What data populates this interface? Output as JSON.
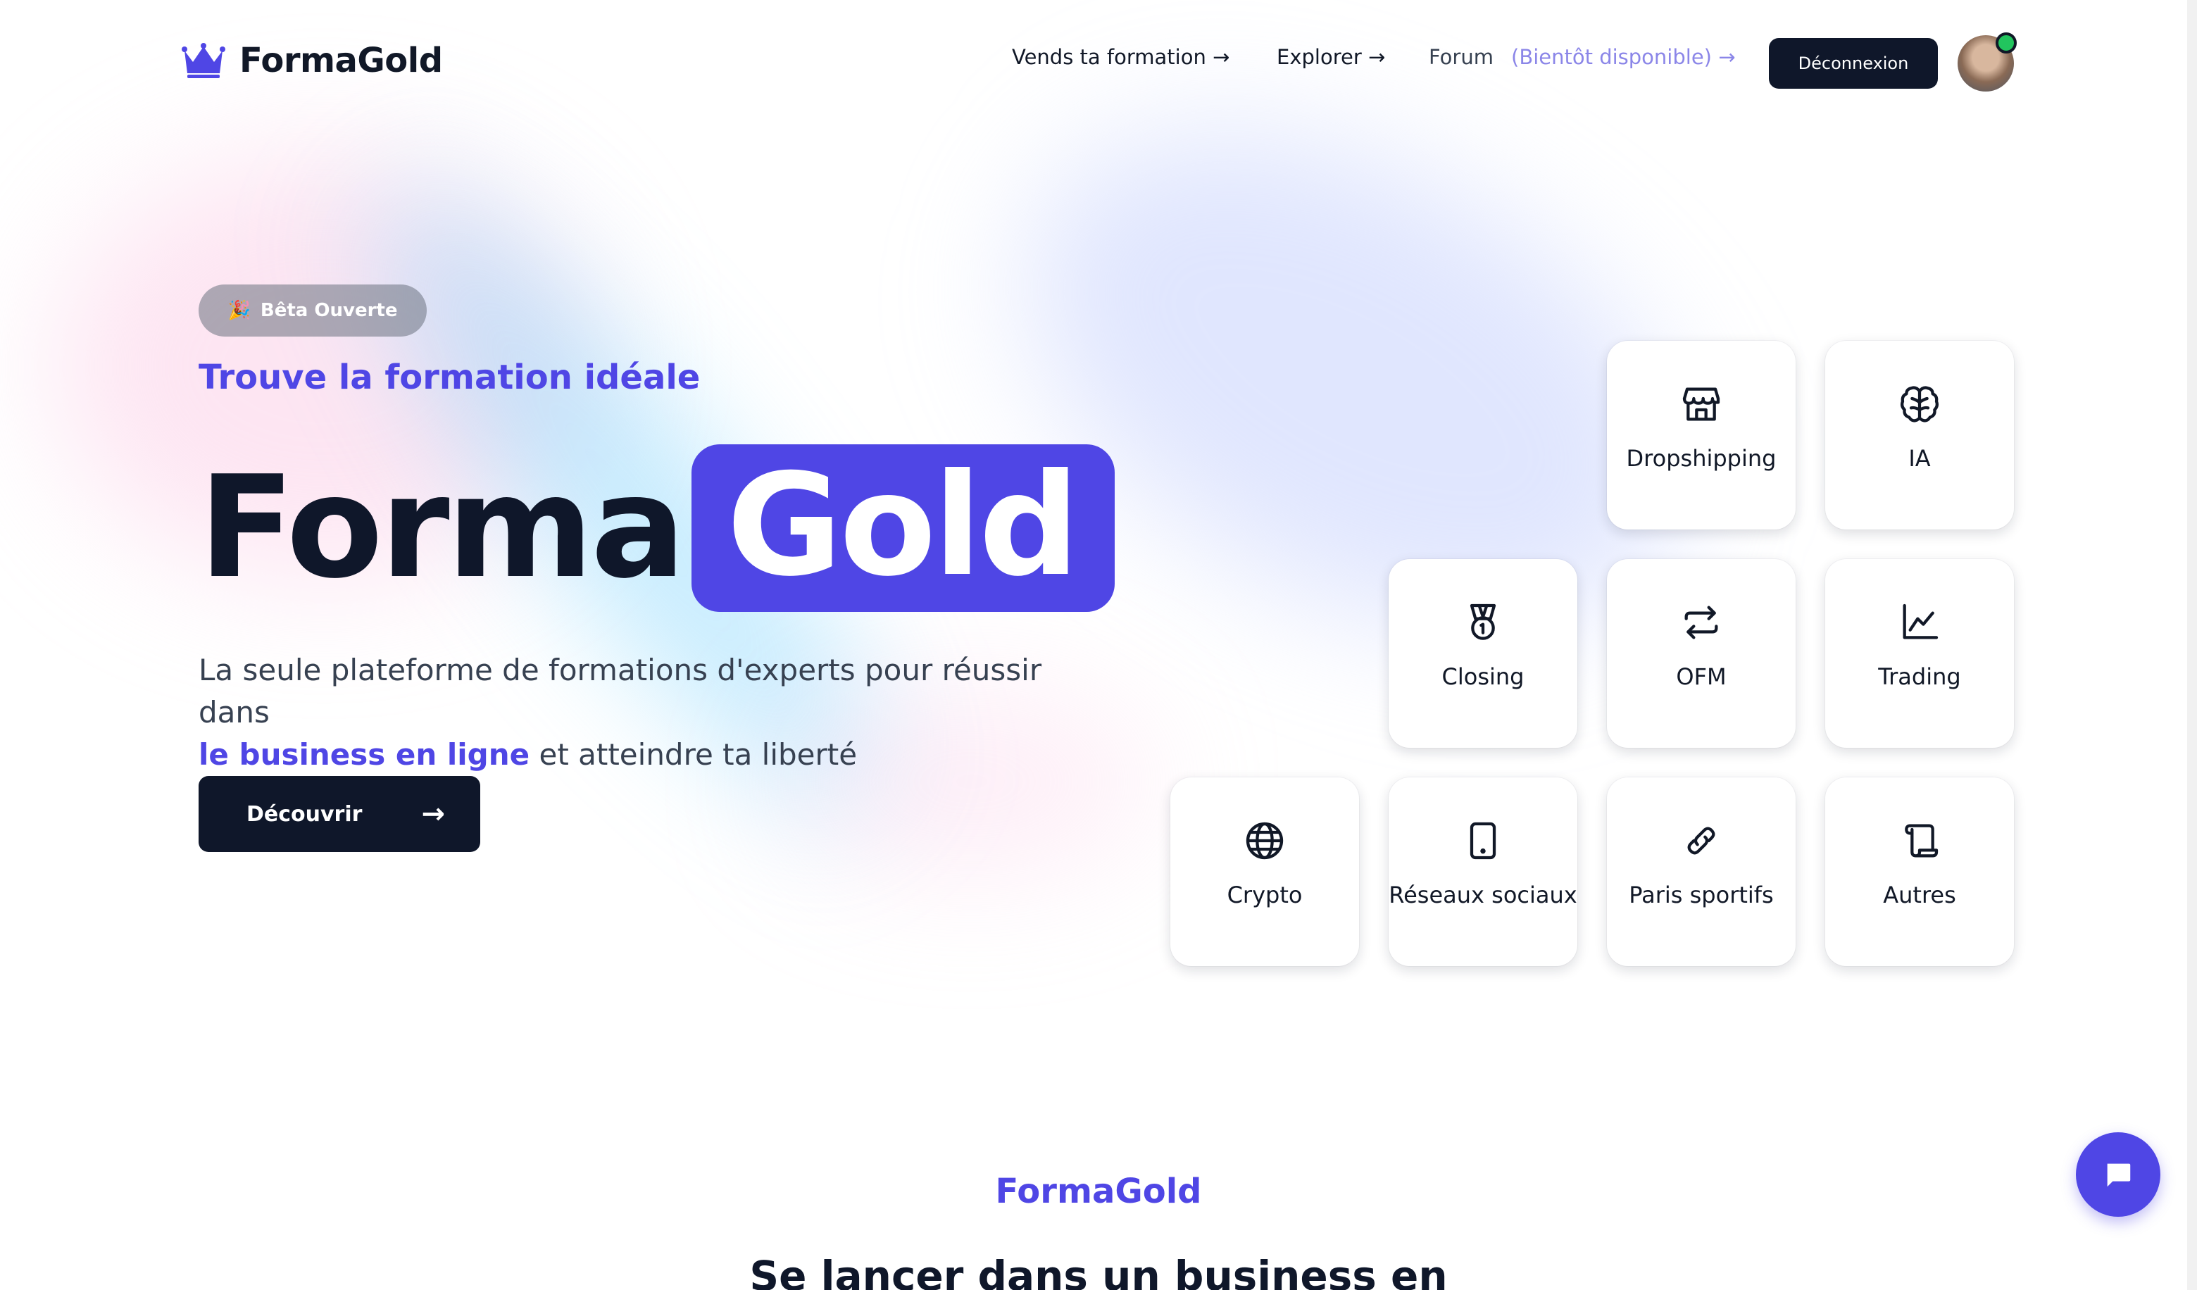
{
  "header": {
    "logo_text": "FormaGold",
    "nav": {
      "vends": "Vends ta formation →",
      "explorer": "Explorer →",
      "forum": "Forum",
      "forum_soon": "(Bientôt disponible) →"
    },
    "logout_label": "Déconnexion"
  },
  "hero": {
    "badge_icon": "🎉",
    "badge_label": "Bêta Ouverte",
    "subtitle": "Trouve la formation idéale",
    "title_part1": "Forma",
    "title_part2": "Gold",
    "desc_line1": "La seule plateforme de formations d'experts pour réussir dans",
    "desc_highlight": "le business en ligne",
    "desc_rest": " et atteindre ta liberté",
    "cta_label": "Découvrir",
    "cta_icon": "→"
  },
  "categories": [
    {
      "label": "Dropshipping",
      "icon": "store-icon"
    },
    {
      "label": "IA",
      "icon": "brain-icon"
    },
    {
      "label": "Closing",
      "icon": "medal-icon"
    },
    {
      "label": "OFM",
      "icon": "repeat-icon"
    },
    {
      "label": "Trading",
      "icon": "chart-line-icon"
    },
    {
      "label": "Crypto",
      "icon": "globe-icon"
    },
    {
      "label": "Réseaux sociaux",
      "icon": "tablet-icon"
    },
    {
      "label": "Paris sportifs",
      "icon": "link-icon"
    },
    {
      "label": "Autres",
      "icon": "scroll-icon"
    }
  ],
  "section": {
    "kicker": "FormaGold",
    "title": "Se lancer dans un business en"
  },
  "colors": {
    "brand": "#4f46e5",
    "dark": "#0f172a",
    "muted_link": "#8b86e8",
    "online_dot": "#22c55e"
  }
}
